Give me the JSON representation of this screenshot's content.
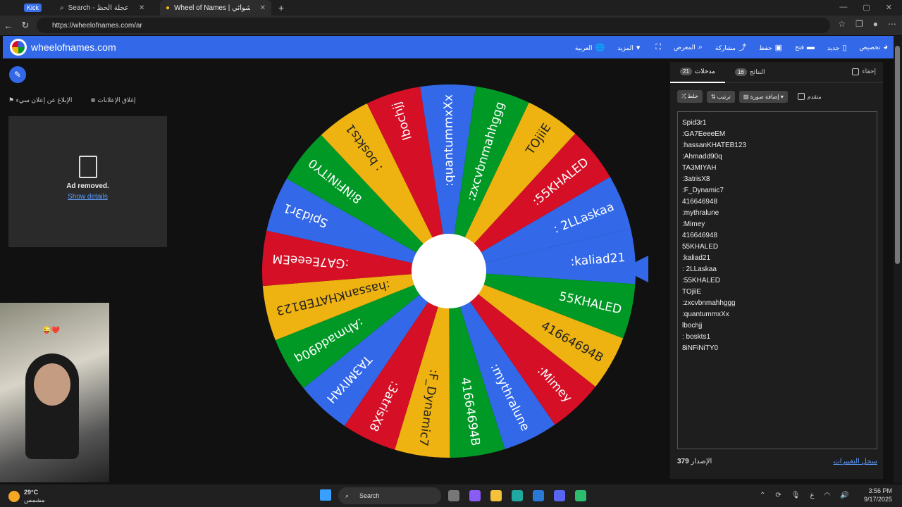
{
  "browser": {
    "tabs": [
      {
        "label": "Search - عجلة الحظ",
        "active": false
      },
      {
        "label": "Wheel of Names | الاسم العشوائي",
        "active": true
      }
    ],
    "kick_label": "Kick",
    "url": "https://wheelofnames.com/ar",
    "new_tab": "+"
  },
  "app": {
    "brand": "wheelofnames.com",
    "menu": [
      {
        "label": "العربية",
        "icon": "globe-icon"
      },
      {
        "label": "المزيد",
        "icon": "caret-down-icon"
      },
      {
        "label": "",
        "icon": "fullscreen-icon"
      },
      {
        "label": "المعرض",
        "icon": "search-icon"
      },
      {
        "label": "مشاركة",
        "icon": "share-icon"
      },
      {
        "label": "حفظ",
        "icon": "save-icon"
      },
      {
        "label": "فتح",
        "icon": "folder-icon"
      },
      {
        "label": "جديد",
        "icon": "file-icon"
      },
      {
        "label": "تخصيص",
        "icon": "palette-icon"
      }
    ]
  },
  "ads": {
    "close_ads": "إغلاق الإعلانات",
    "report_ad": "الإبلاغ عن إعلان سيء",
    "removed": "Ad removed.",
    "show_details": "Show details"
  },
  "wheel": {
    "colors": [
      "#3369e8",
      "#009925",
      "#eeb211",
      "#d50f25"
    ],
    "segments": [
      ":kaliad21",
      "55KHALED",
      "41664694B",
      ":Mimey",
      ":mythralune",
      "41664694B",
      ":F_Dynamic7",
      ":3atrisX8",
      "TA3MIYAH",
      ":Ahmadd90q",
      ":hassanKHATEB123",
      ":GA7EeeeEM",
      "Spid3r1",
      "8iNFiNiTY0",
      ": boskts1",
      "lbochjj",
      ":quantummxXx",
      ":zxcvbnmahhggg",
      "TOjiiE",
      ":55KHALED",
      ": 2LLaskaa"
    ]
  },
  "panel": {
    "tab_entries": {
      "label": "مدخلات",
      "count": "21"
    },
    "tab_results": {
      "label": "النتائج",
      "count": "16"
    },
    "hide_label": "إخفاء",
    "tools": {
      "shuffle": "خلط",
      "sort": "ترتيب",
      "add_image": "إضافة صورة",
      "advanced": "متقدم"
    },
    "entries": [
      "Spid3r1",
      ":GA7EeeeEM",
      ":hassanKHATEB123",
      ":Ahmadd90q",
      "TA3MIYAH",
      ":3atrisX8",
      ":F_Dynamic7",
      "416646948",
      ":mythralune",
      ":Mimey",
      "416646948",
      "55KHALED",
      ":kaliad21",
      ": 2LLaskaa",
      ":55KHALED",
      "TOjiiE",
      ":zxcvbnmahhggg",
      ":quantummxXx",
      "lbochjj",
      ": boskts1",
      "8iNFiNiTY0"
    ],
    "version_label": "الإصدار",
    "version": "379",
    "changelog": "سجل التغييرات"
  },
  "taskbar": {
    "temp": "29°C",
    "weather": "مشمس",
    "search": "Search",
    "time": "3:56 PM",
    "date": "9/17/2025",
    "lang": "ع"
  }
}
